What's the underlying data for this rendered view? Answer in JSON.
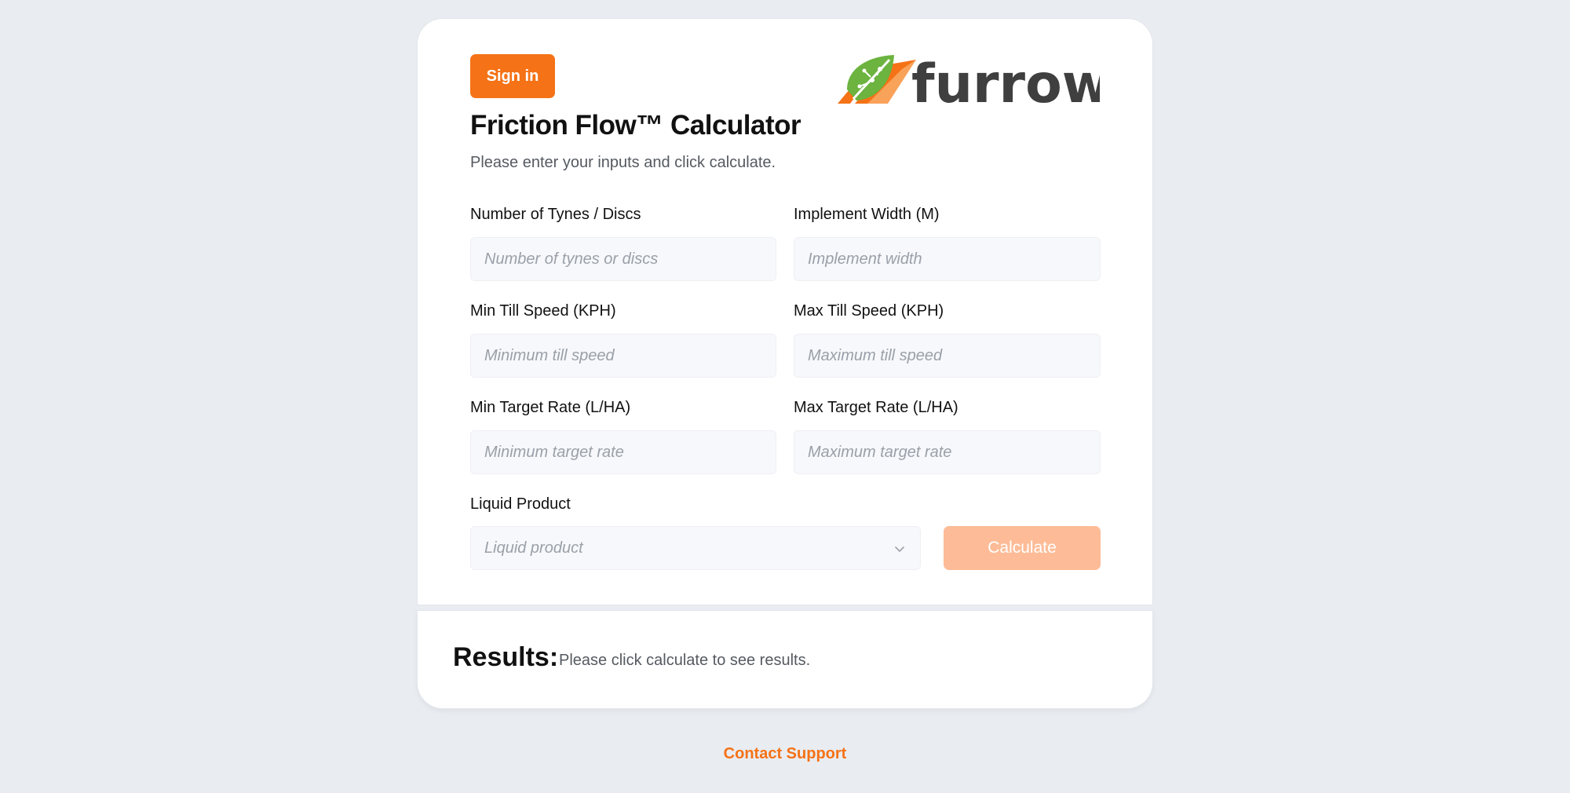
{
  "header": {
    "signin_label": "Sign in",
    "logo_text": "furrow",
    "title": "Friction Flow™ Calculator",
    "subtitle": "Please enter your inputs and click calculate."
  },
  "form": {
    "tynes": {
      "label": "Number of Tynes / Discs",
      "placeholder": "Number of tynes or discs",
      "value": ""
    },
    "width": {
      "label": "Implement Width (M)",
      "placeholder": "Implement width",
      "value": ""
    },
    "min_speed": {
      "label": "Min Till Speed (KPH)",
      "placeholder": "Minimum till speed",
      "value": ""
    },
    "max_speed": {
      "label": "Max Till Speed (KPH)",
      "placeholder": "Maximum till speed",
      "value": ""
    },
    "min_rate": {
      "label": "Min Target Rate (L/HA)",
      "placeholder": "Minimum target rate",
      "value": ""
    },
    "max_rate": {
      "label": "Max Target Rate (L/HA)",
      "placeholder": "Maximum target rate",
      "value": ""
    },
    "product": {
      "label": "Liquid Product",
      "placeholder": "Liquid product",
      "selected": ""
    },
    "calculate_label": "Calculate"
  },
  "results": {
    "heading": "Results:",
    "message": "Please click calculate to see results."
  },
  "footer": {
    "support_label": "Contact Support"
  },
  "colors": {
    "accent": "#f57216",
    "accent_disabled": "#fdbc97",
    "logo_dark": "#3f3f3f",
    "logo_green": "#6cb33f",
    "background": "#e9ecf1"
  },
  "icons": {
    "logo": "furrow-leaf-logo-icon",
    "select": "chevron-down-icon"
  }
}
